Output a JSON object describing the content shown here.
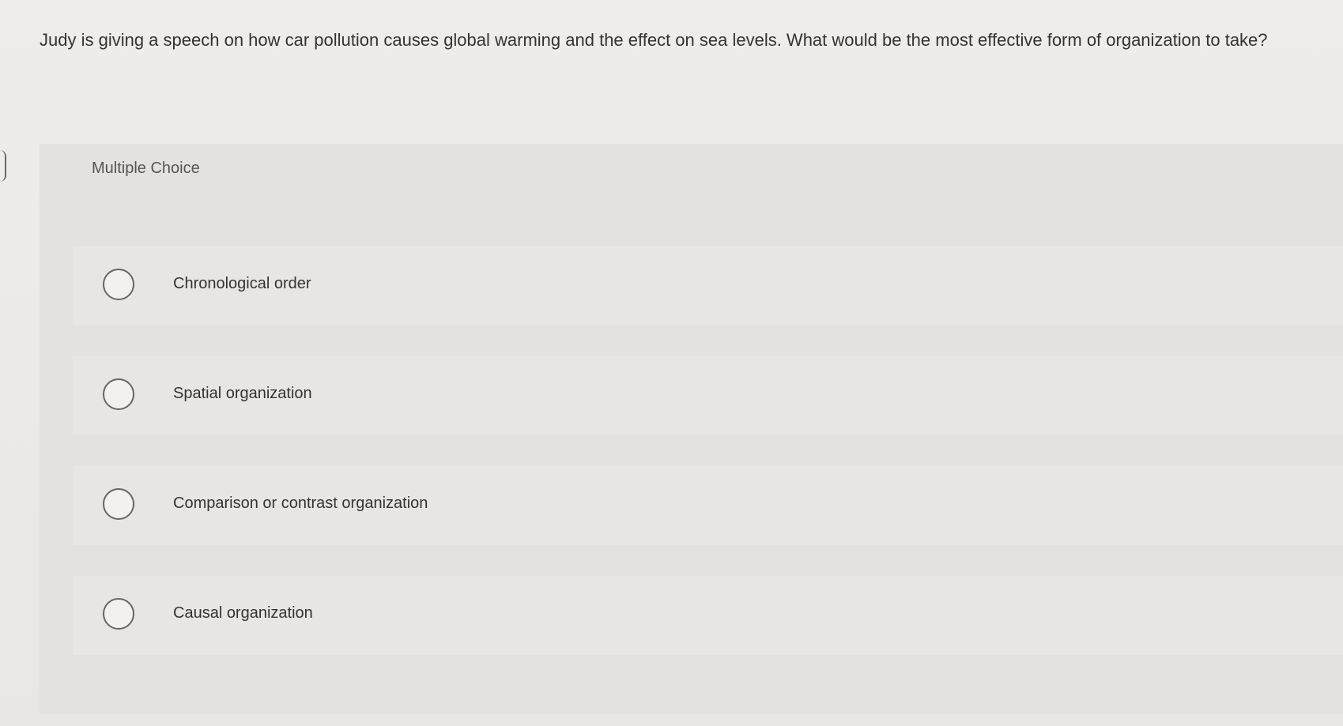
{
  "question": {
    "text": "Judy is giving a speech on how car pollution causes global warming and the effect on sea levels. What would be the most effective form of organization to take?"
  },
  "panel": {
    "label": "Multiple Choice"
  },
  "choices": [
    {
      "label": "Chronological order"
    },
    {
      "label": "Spatial organization"
    },
    {
      "label": "Comparison or contrast organization"
    },
    {
      "label": "Causal organization"
    }
  ]
}
